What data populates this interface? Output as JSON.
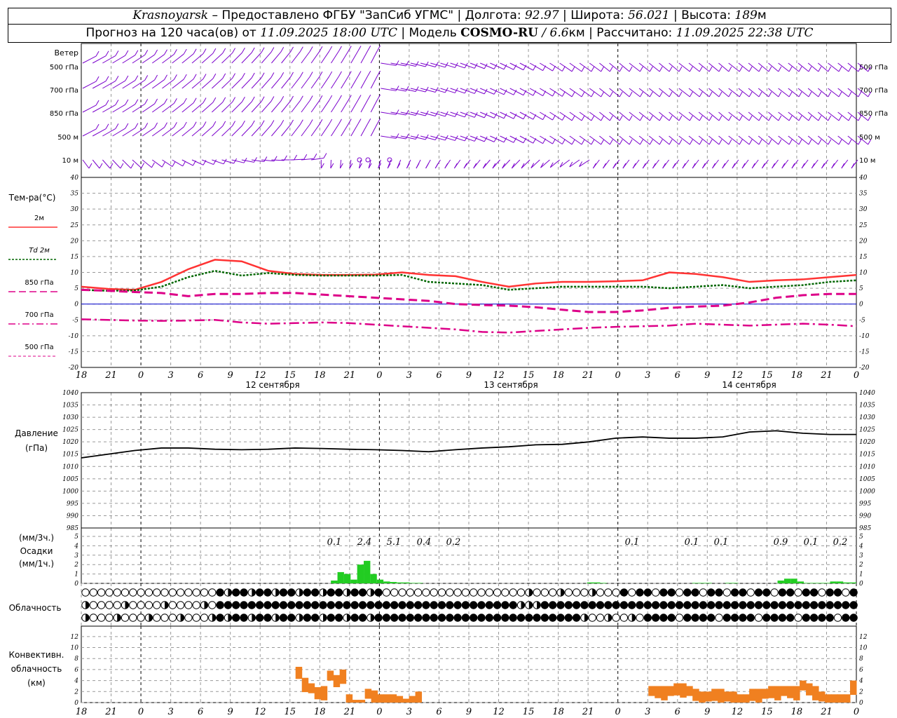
{
  "header": {
    "station": "Krasnoyarsk",
    "provider": " – Предоставлено ФГБУ \"ЗапСиб УГМС\" | Долгота: ",
    "lon": "92.97",
    "lat_label": " | Широта: ",
    "lat": "56.021",
    "alt_label": " | Высота: ",
    "alt": "189",
    "alt_unit": "м",
    "forecast_label": "Прогноз на 120 часа(ов) от ",
    "forecast_start": "11.09.2025 18:00 UTC",
    "model_label": " | Модель ",
    "model": "COSMO-RU",
    "model_res_sep": " / ",
    "model_res": "6.6",
    "model_res_unit": "км",
    "calc_label": " | Рассчитано: ",
    "calc_time": "11.09.2025 22:38 UTC"
  },
  "colors": {
    "wind": "#7a00cc",
    "t2m": "#ff3333",
    "td2m": "#006600",
    "t850": "#dd0088",
    "t700": "#dd0088",
    "t500": "#dd0088",
    "zero_line": "#0000cc",
    "pressure": "#000000",
    "precip": "#22cc22",
    "convective": "#f08020",
    "grid": "#999999"
  },
  "wind_panel": {
    "title": "Ветер",
    "levels": [
      "500 гПа",
      "700 гПа",
      "850 гПа",
      "500 м",
      "10  м"
    ]
  },
  "temp_panel": {
    "title": "Тем-ра(°C)",
    "legend": [
      "2м",
      "Td  2м",
      "850 гПа",
      "700 гПа",
      "500 гПа"
    ],
    "y_ticks": [
      "40",
      "35",
      "30",
      "25",
      "20",
      "15",
      "10",
      "5",
      "0",
      "-5",
      "-10",
      "-15",
      "-20"
    ]
  },
  "x_axis": {
    "hour_labels": [
      "18",
      "21",
      "0",
      "3",
      "6",
      "9",
      "12",
      "15",
      "18",
      "21",
      "0",
      "3",
      "6",
      "9",
      "12",
      "15",
      "18",
      "21",
      "0",
      "3",
      "6",
      "9",
      "12",
      "15",
      "18",
      "21",
      "0"
    ],
    "day_labels": [
      "12 сентября",
      "13 сентября",
      "14 сентября"
    ]
  },
  "pressure_panel": {
    "title": "Давление",
    "unit": "(гПа)",
    "y_ticks": [
      "1040",
      "1035",
      "1030",
      "1025",
      "1020",
      "1015",
      "1010",
      "1005",
      "1000",
      "995",
      "990",
      "985"
    ]
  },
  "precip_panel": {
    "title_top": "(мм/3ч.)",
    "title": "Осадки",
    "title_bottom": "(мм/1ч.)",
    "y_ticks": [
      "5",
      "4",
      "3",
      "2",
      "1",
      "0"
    ],
    "three_hour_totals": [
      {
        "hour": "21",
        "value": "0.1"
      },
      {
        "hour": "0a",
        "value": "2.4"
      },
      {
        "hour": "3a",
        "value": "5.1"
      },
      {
        "hour": "6a",
        "value": "0.4"
      },
      {
        "hour": "9a",
        "value": "0.2"
      },
      {
        "hour": "3c",
        "value": "0.1"
      },
      {
        "hour": "9c",
        "value": "0.1"
      },
      {
        "hour": "12c",
        "value": "0.1"
      },
      {
        "hour": "18c",
        "value": "0.9"
      },
      {
        "hour": "21c",
        "value": "0.1"
      },
      {
        "hour": "0d",
        "value": "0.2"
      }
    ]
  },
  "cloud_panel": {
    "title": "Облачность"
  },
  "conv_panel": {
    "title_1": "Конвективн.",
    "title_2": "облачность",
    "title_3": "(км)",
    "y_ticks": [
      "12",
      "10",
      "8",
      "6",
      "4",
      "2",
      "0"
    ]
  },
  "chart_data": [
    {
      "type": "line",
      "title": "Тем-ра(°C)",
      "x": [
        0,
        3,
        6,
        9,
        12,
        15,
        18,
        21,
        24,
        27,
        30,
        33,
        36,
        39,
        42,
        45,
        48,
        51,
        54,
        57,
        60,
        63,
        66,
        69,
        72,
        75,
        78
      ],
      "ylim": [
        -20,
        40
      ],
      "series": [
        {
          "name": "2м",
          "values": [
            5.5,
            4.8,
            4.5,
            7,
            11,
            14,
            13.5,
            10.5,
            9.5,
            9.2,
            9.2,
            9.3,
            10,
            9.2,
            8.8,
            7,
            5.5,
            6.5,
            7,
            7,
            7.2,
            7.5,
            10,
            9.5,
            8.5,
            7,
            7.5,
            7.8,
            8.5,
            9.2
          ]
        },
        {
          "name": "Td  2м",
          "values": [
            4.5,
            4.2,
            4.3,
            5.5,
            8.5,
            10.5,
            9,
            9.8,
            9.2,
            9,
            9,
            9,
            9.2,
            7,
            6.5,
            6,
            4.5,
            5,
            5.5,
            5.5,
            5.5,
            5.5,
            5,
            5.5,
            6,
            5,
            5.5,
            6,
            7,
            7.5
          ]
        },
        {
          "name": "850 гПа",
          "values": [
            4.5,
            4.2,
            3.8,
            3.5,
            2.5,
            3.2,
            3.2,
            3.5,
            3.5,
            3,
            2.5,
            2,
            1.5,
            1,
            0,
            -0.3,
            -0.5,
            -1,
            -1.8,
            -2.5,
            -2.5,
            -2,
            -1.2,
            -0.8,
            -0.5,
            0.5,
            2,
            2.8,
            3.2,
            3.2
          ]
        },
        {
          "name": "700 гПа",
          "values": [
            -4.8,
            -5,
            -5.2,
            -5.3,
            -5.2,
            -5,
            -5.8,
            -6.2,
            -6,
            -5.8,
            -6,
            -6.5,
            -7,
            -7.5,
            -8,
            -8.8,
            -9,
            -8.5,
            -8,
            -7.5,
            -7.2,
            -7,
            -6.8,
            -6.2,
            -6.5,
            -6.8,
            -6.5,
            -6.2,
            -6.5,
            -7
          ]
        }
      ]
    },
    {
      "type": "line",
      "title": "Давление",
      "ylim": [
        985,
        1040
      ],
      "series": [
        {
          "name": "",
          "values": [
            1013.5,
            1015,
            1016.5,
            1017.5,
            1017.5,
            1017,
            1016.8,
            1017,
            1017.5,
            1017.3,
            1017,
            1016.8,
            1016.5,
            1016,
            1016.8,
            1017.5,
            1018,
            1018.8,
            1019,
            1020,
            1021.5,
            1022,
            1021.5,
            1021.5,
            1022,
            1024,
            1024.5,
            1023.5,
            1023,
            1023
          ]
        }
      ]
    },
    {
      "type": "bar",
      "title": "Осадки",
      "ylim": [
        0,
        5
      ],
      "values": [
        0,
        0,
        0,
        0,
        0,
        0,
        0,
        0,
        0,
        0,
        0,
        0,
        0,
        0,
        0,
        0,
        0,
        0,
        0,
        0,
        0,
        0,
        0,
        0,
        0,
        0,
        0,
        0,
        0,
        0,
        0,
        0,
        0,
        0,
        0,
        0,
        0,
        0,
        0.3,
        1.2,
        1.0,
        0.4,
        2.0,
        2.4,
        1.0,
        0.4,
        0.2,
        0.15,
        0.1,
        0.1,
        0.05,
        0.05,
        0,
        0,
        0,
        0,
        0,
        0,
        0,
        0,
        0,
        0,
        0,
        0,
        0,
        0,
        0,
        0,
        0,
        0,
        0,
        0,
        0,
        0,
        0,
        0,
        0,
        0.1,
        0.1,
        0.05,
        0,
        0,
        0,
        0,
        0,
        0,
        0,
        0,
        0,
        0,
        0,
        0,
        0,
        0.05,
        0.05,
        0.05,
        0,
        0,
        0.05,
        0.05,
        0,
        0,
        0,
        0,
        0,
        0,
        0.3,
        0.5,
        0.5,
        0.2,
        0.05,
        0.05,
        0.05,
        0.05,
        0.2,
        0.2,
        0.1,
        0.1
      ]
    },
    {
      "type": "bar",
      "title": "Конвективн. облачность",
      "ylim": [
        0,
        13
      ],
      "values": [
        0,
        0,
        0,
        0,
        0,
        0,
        0,
        0,
        0,
        0,
        0,
        0,
        0,
        0,
        0,
        0,
        0,
        0,
        0,
        0,
        0,
        0,
        0,
        0,
        0,
        0,
        0,
        0,
        0,
        0,
        0,
        0,
        0,
        0,
        6.5,
        4.5,
        3.5,
        2.8,
        3,
        5.8,
        5,
        6,
        1.5,
        0.5,
        0.5,
        2.5,
        2.2,
        1.5,
        1.5,
        1.5,
        1.2,
        0.7,
        1.2,
        2,
        0,
        0,
        0,
        0,
        0,
        0,
        0,
        0,
        0,
        0,
        0,
        0,
        0,
        0,
        0,
        0,
        0,
        0,
        0,
        0,
        0,
        0,
        0,
        0,
        0,
        0,
        0,
        0,
        0,
        0,
        0,
        0,
        0,
        0,
        0,
        0,
        3,
        3,
        3,
        3,
        3.5,
        3.5,
        3,
        2.5,
        2,
        2,
        2.5,
        2.5,
        2,
        2,
        1.5,
        1.5,
        2.5,
        2.5,
        2.5,
        3,
        3,
        3,
        3,
        3,
        4,
        3.5,
        3,
        2,
        1.5,
        1.5,
        1.5,
        1.5,
        4
      ]
    }
  ]
}
